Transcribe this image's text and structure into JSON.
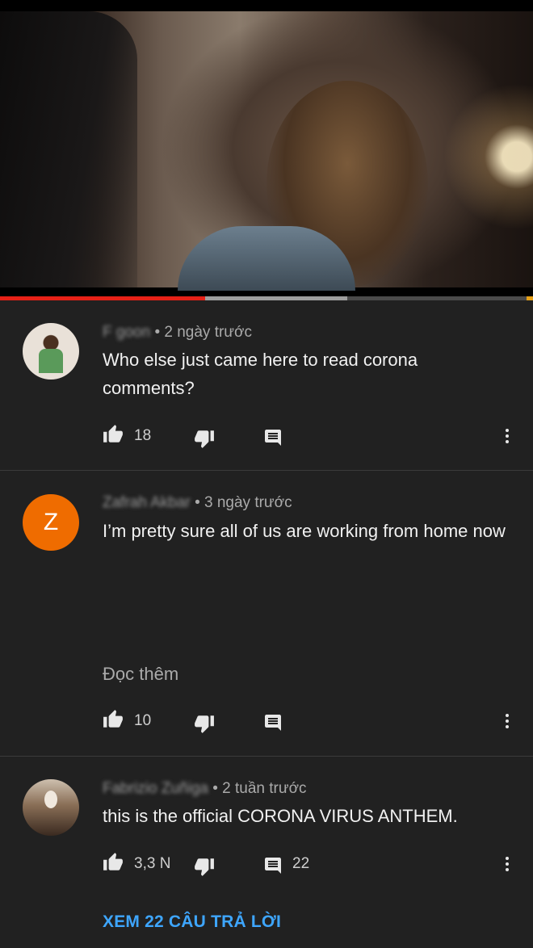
{
  "video": {
    "progress_played": 0.385,
    "progress_buffered_end": 0.652
  },
  "comments": [
    {
      "author": "F goon",
      "time": "• 2 ngày trước",
      "text": "Who else just came here to read corona comments?",
      "likes": "18",
      "replies": "",
      "avatar": "photo"
    },
    {
      "author": "Zafrah Akbar",
      "time": "• 3 ngày trước",
      "text": "I’m pretty sure all of us are working from home now",
      "read_more": "Đọc thêm",
      "likes": "10",
      "replies": "",
      "avatar_letter": "Z"
    },
    {
      "author": "Fabrizio Zuñiga",
      "time": "• 2 tuần trước",
      "text": "this is the official CORONA VIRUS ANTHEM.",
      "likes": "3,3 N",
      "replies": "22",
      "avatar": "photo"
    }
  ],
  "view_replies": "XEM 22 CÂU TRẢ LỜI",
  "icons": {
    "like": "thumb-up-icon",
    "dislike": "thumb-down-icon",
    "reply": "comment-icon",
    "more": "more-vert-icon"
  },
  "colors": {
    "background": "#212121",
    "progress_played": "#e62117",
    "link": "#3ea6ff",
    "avatar_z": "#ef6c00"
  }
}
